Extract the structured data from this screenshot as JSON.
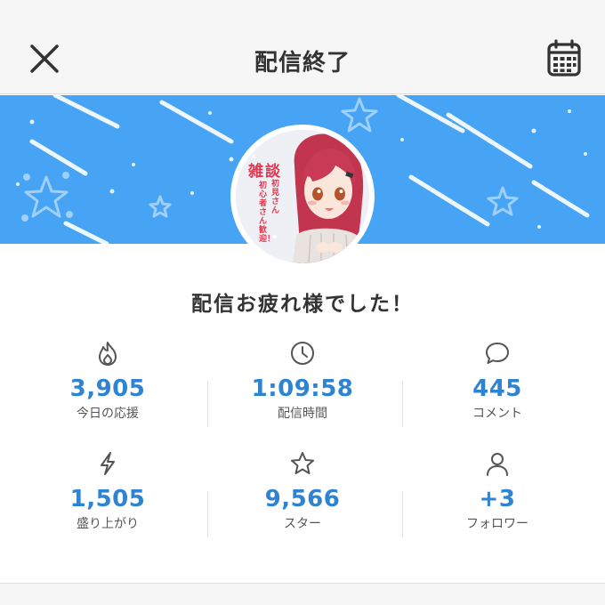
{
  "header": {
    "title": "配信終了",
    "close_icon": "close-icon",
    "calendar_icon": "calendar-icon"
  },
  "banner": {
    "color": "#47a3f3"
  },
  "avatar": {
    "thumbnail_title": "雑談",
    "thumbnail_line1": "初見さん",
    "thumbnail_line2": "初心者さん歓迎！"
  },
  "message": "配信お疲れ様でした！",
  "stats": [
    {
      "icon": "flame-icon",
      "value": "3,905",
      "label": "今日の応援"
    },
    {
      "icon": "clock-icon",
      "value": "1:09:58",
      "label": "配信時間"
    },
    {
      "icon": "comment-icon",
      "value": "445",
      "label": "コメント"
    },
    {
      "icon": "lightning-icon",
      "value": "1,505",
      "label": "盛り上がり"
    },
    {
      "icon": "star-icon",
      "value": "9,566",
      "label": "スター"
    },
    {
      "icon": "user-icon",
      "value": "+3",
      "label": "フォロワー"
    }
  ],
  "colors": {
    "accent": "#2f83d3",
    "banner": "#47a3f3"
  }
}
